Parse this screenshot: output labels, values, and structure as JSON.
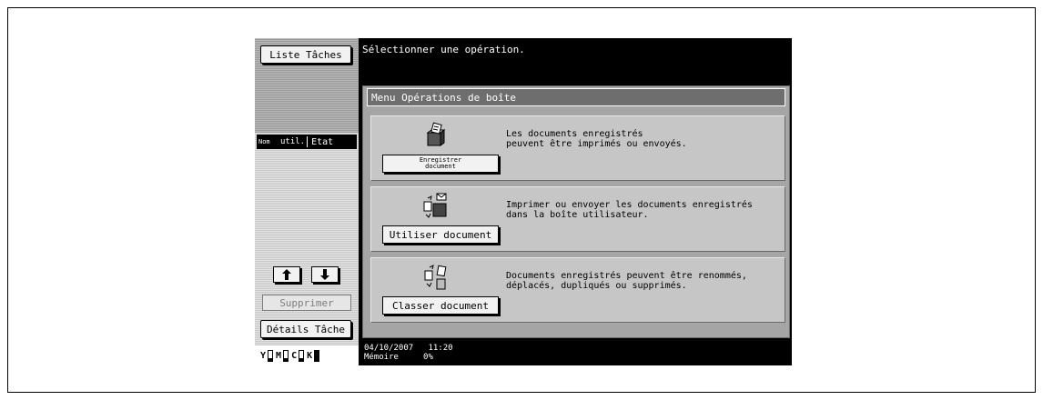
{
  "left_panel": {
    "liste_taches": "Liste Tâches",
    "header_nom": "Nom",
    "header_util": "util.",
    "header_etat": "Etat",
    "supprimer": "Supprimer",
    "details_tache": "Détails Tâche"
  },
  "toner": [
    {
      "label": "Y",
      "level": 0.2
    },
    {
      "label": "M",
      "level": 0.2
    },
    {
      "label": "C",
      "level": 0.2
    },
    {
      "label": "K",
      "level": 0.95
    }
  ],
  "message": "Sélectionner une opération.",
  "panel_title": "Menu Opérations de boîte",
  "operations": [
    {
      "button_line1": "Enregistrer",
      "button_line2": "document",
      "description": "Les documents enregistrés\npeuvent être imprimés ou envoyés.",
      "icon": "box-save-icon"
    },
    {
      "button": "Utiliser document",
      "description": "Imprimer ou envoyer les documents enregistrés\ndans la boîte utilisateur.",
      "icon": "box-use-icon"
    },
    {
      "button": "Classer document",
      "description": "Documents enregistrés peuvent être renommés,\ndéplacés, dupliqués ou supprimés.",
      "icon": "box-file-icon"
    }
  ],
  "status": {
    "date": "04/10/2007",
    "time": "11:20",
    "memory_label": "Mémoire",
    "memory_value": "0%"
  }
}
